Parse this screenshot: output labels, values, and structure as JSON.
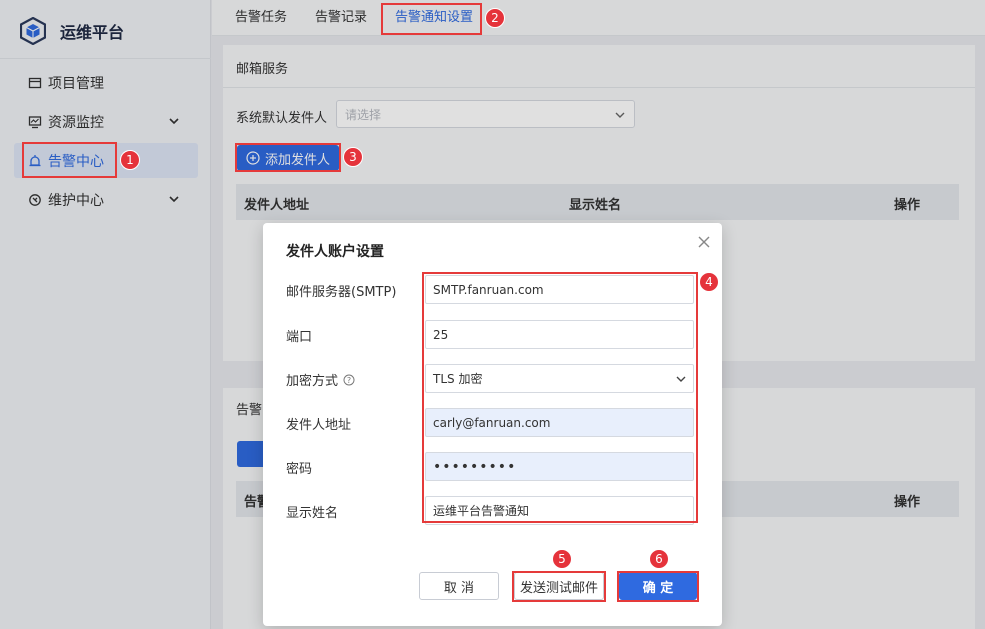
{
  "app": {
    "title": "运维平台"
  },
  "sidebar": {
    "items": [
      {
        "label": "项目管理",
        "icon": "project-icon"
      },
      {
        "label": "资源监控",
        "icon": "monitor-icon",
        "expandable": true
      },
      {
        "label": "告警中心",
        "icon": "alarm-icon",
        "active": true
      },
      {
        "label": "维护中心",
        "icon": "maintenance-icon",
        "expandable": true
      }
    ]
  },
  "tabs": [
    {
      "label": "告警任务"
    },
    {
      "label": "告警记录"
    },
    {
      "label": "告警通知设置",
      "active": true
    }
  ],
  "mail_service": {
    "title": "邮箱服务",
    "default_sender_label": "系统默认发件人",
    "default_sender_placeholder": "请选择",
    "add_sender_label": "添加发件人",
    "table_headers": [
      "发件人地址",
      "显示姓名",
      "操作"
    ]
  },
  "second_section": {
    "title_partial": "告警",
    "header_partial": "告警",
    "operation_header": "操作"
  },
  "modal": {
    "title": "发件人账户设置",
    "fields": [
      {
        "label": "邮件服务器(SMTP)",
        "value": "SMTP.fanruan.com"
      },
      {
        "label": "端口",
        "value": "25"
      },
      {
        "label": "加密方式",
        "value": "TLS 加密",
        "has_help": true
      },
      {
        "label": "发件人地址",
        "value": "carly@fanruan.com"
      },
      {
        "label": "密码",
        "value": "•••••••••"
      },
      {
        "label": "显示姓名",
        "value": "运维平台告警通知"
      }
    ],
    "buttons": {
      "cancel": "取 消",
      "test": "发送测试邮件",
      "confirm": "确 定"
    }
  },
  "annotations": [
    "1",
    "2",
    "3",
    "4",
    "5",
    "6"
  ],
  "colors": {
    "accent": "#2f6ae0",
    "annotation_red": "#e53a3a"
  }
}
